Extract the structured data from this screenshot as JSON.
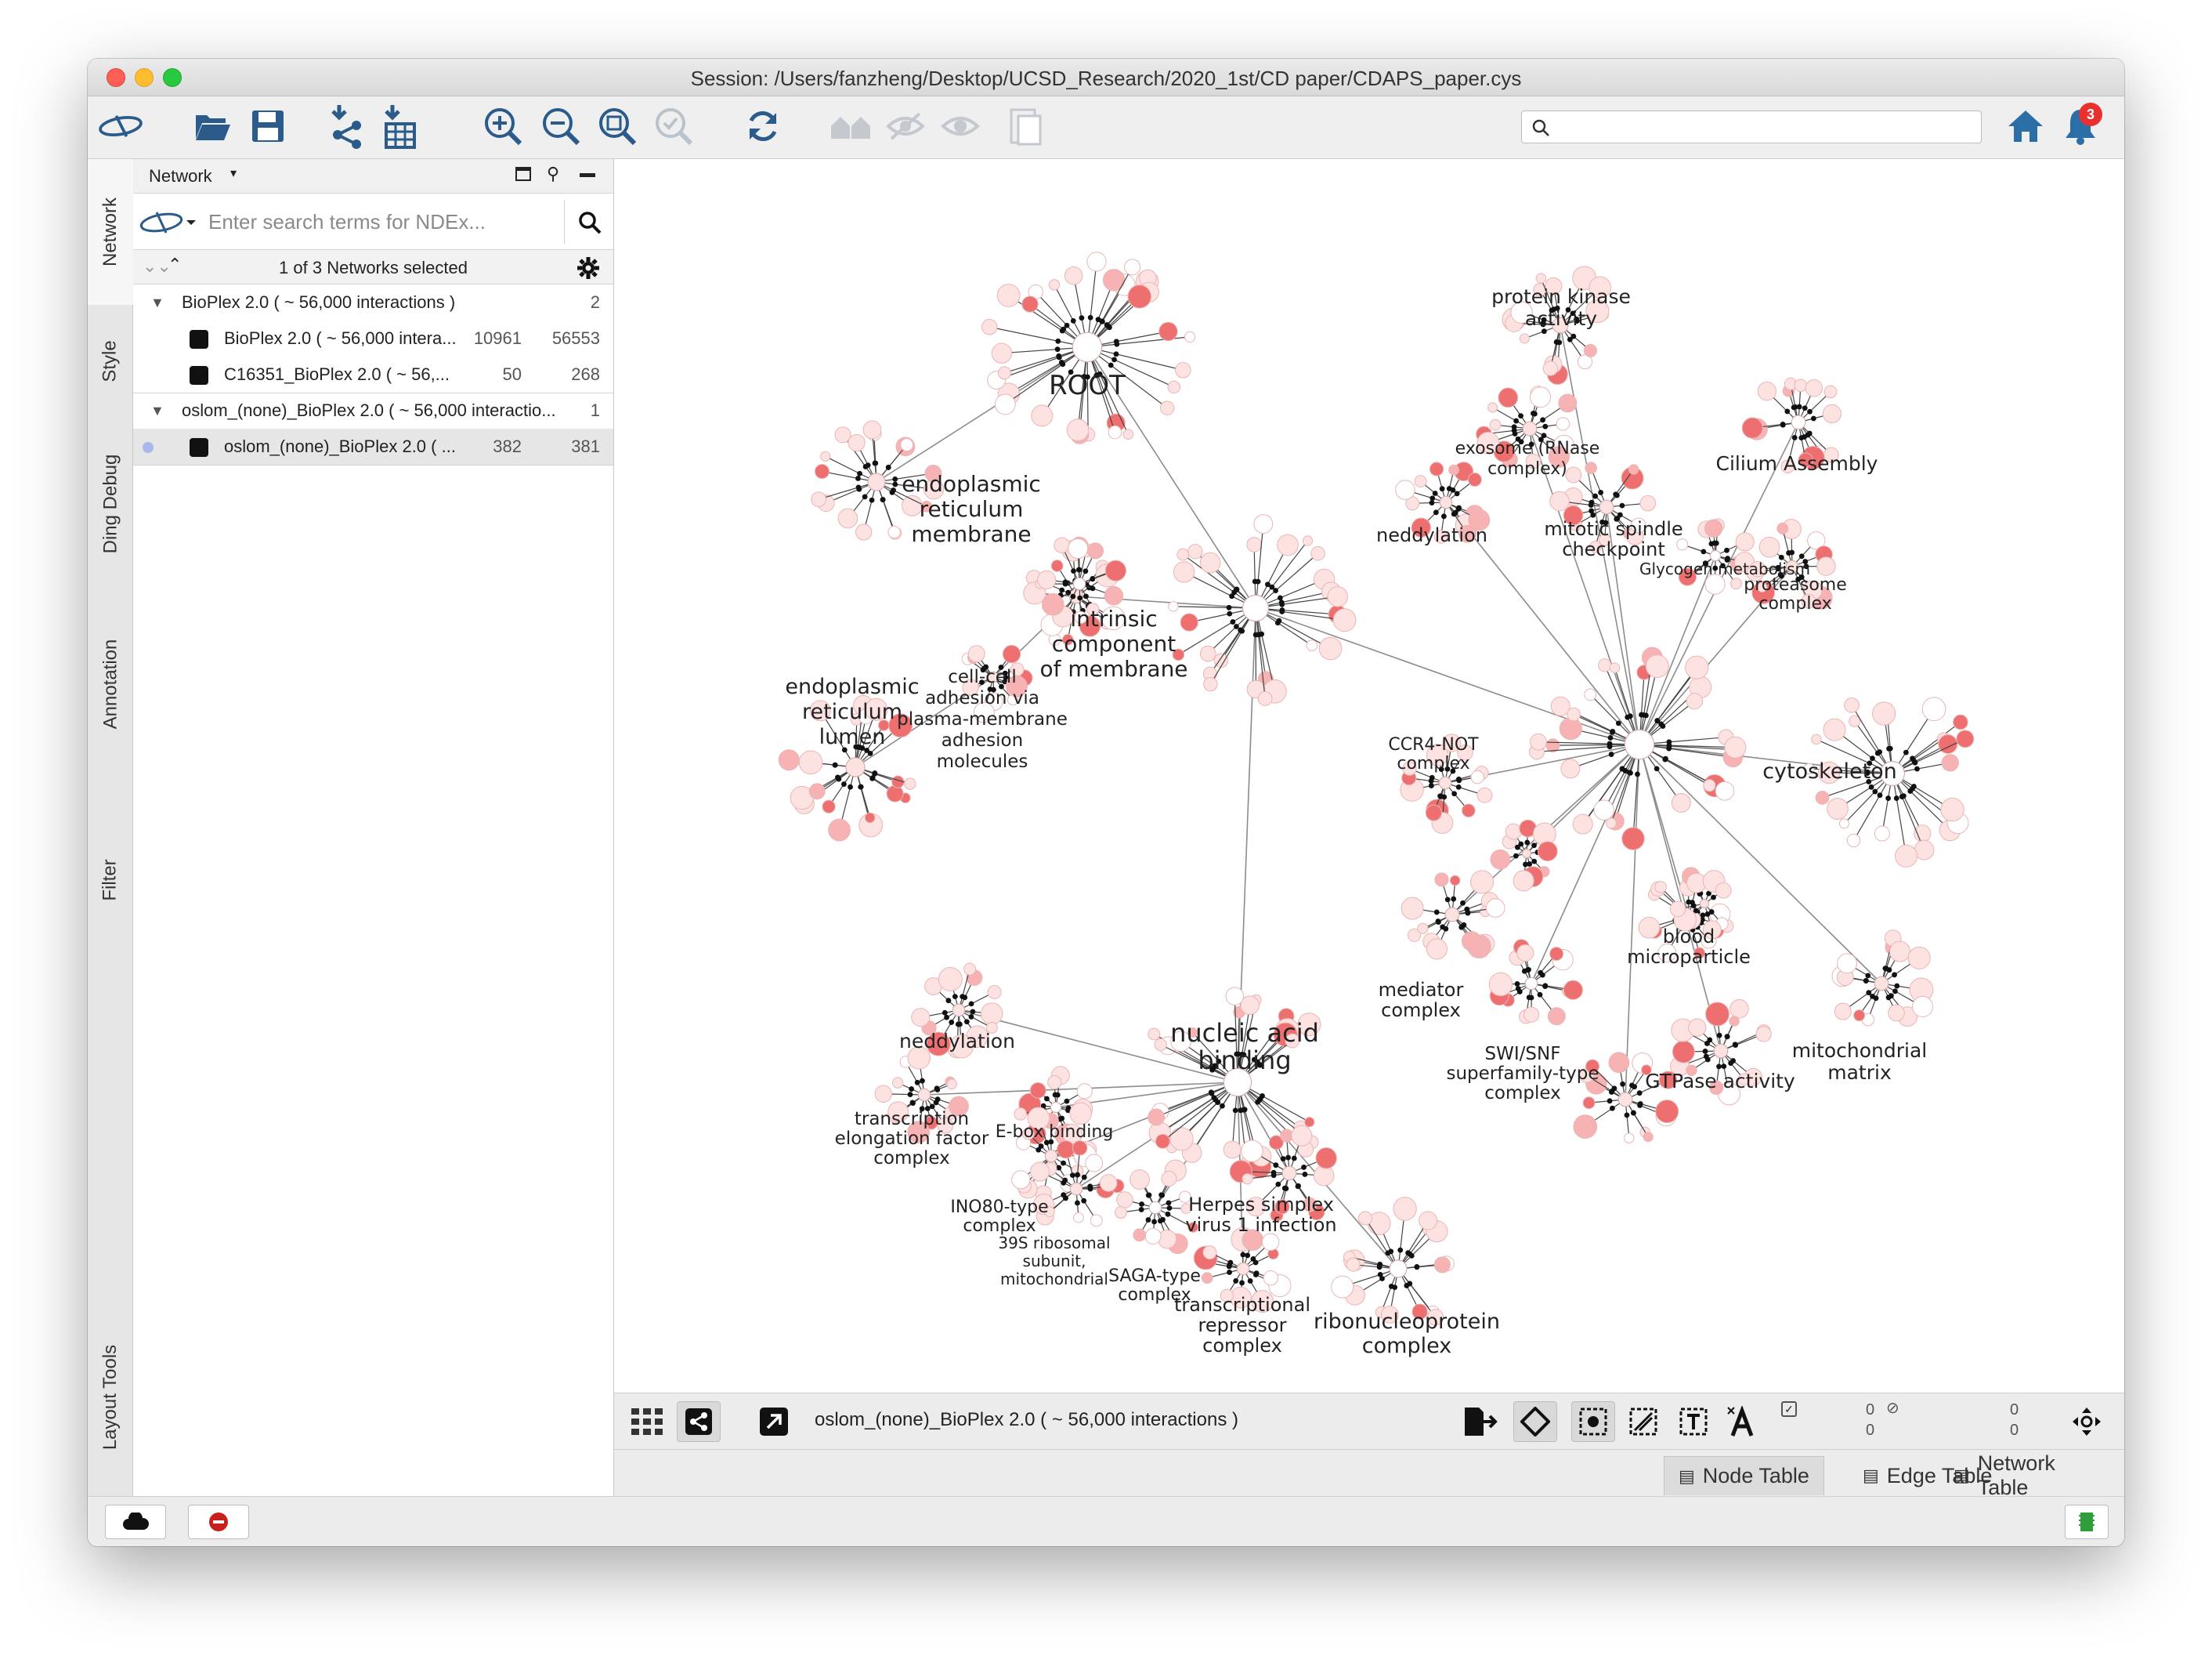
{
  "window": {
    "title": "Session: /Users/fanzheng/Desktop/UCSD_Research/2020_1st/CD paper/CDAPS_paper.cys"
  },
  "toolbar": {
    "icons": [
      "ndex-icon",
      "open-folder-icon",
      "save-icon",
      "import-network-icon",
      "import-table-icon",
      "zoom-in-icon",
      "zoom-out-icon",
      "zoom-fit-icon",
      "zoom-selected-icon",
      "refresh-icon",
      "show-neighbors-icon",
      "hide-icon",
      "show-icon",
      "clipboard-icon",
      "home-icon",
      "notifications-icon"
    ],
    "search_placeholder": "",
    "notification_count": "3"
  },
  "side_tabs": [
    "Network",
    "Style",
    "Ding Debug",
    "Annotation",
    "Filter",
    "Layout Tools"
  ],
  "panel": {
    "title": "Network",
    "ndex_placeholder": "Enter search terms for NDEx...",
    "selection_text": "1 of 3 Networks selected",
    "tree": [
      {
        "label": "BioPlex 2.0 ( ~ 56,000 interactions )",
        "count": "2",
        "kind": "collection"
      },
      {
        "label": "BioPlex 2.0 ( ~ 56,000 intera...",
        "nodes": "10961",
        "edges": "56553",
        "kind": "network"
      },
      {
        "label": "C16351_BioPlex 2.0 ( ~ 56,...",
        "nodes": "50",
        "edges": "268",
        "kind": "network"
      },
      {
        "label": "oslom_(none)_BioPlex 2.0 ( ~ 56,000 interactio...",
        "count": "1",
        "kind": "collection"
      },
      {
        "label": "oslom_(none)_BioPlex 2.0 ( ...",
        "nodes": "382",
        "edges": "381",
        "kind": "network",
        "selected": true
      }
    ]
  },
  "graph": {
    "labels": {
      "root": "ROOT",
      "er_membrane": [
        "endoplasmic",
        "reticulum",
        "membrane"
      ],
      "intrinsic": [
        "intrinsic",
        "component",
        "of membrane"
      ],
      "er_lumen": [
        "endoplasmic",
        "reticulum",
        "lumen"
      ],
      "cell_adhesion": [
        "cell-cell",
        "adhesion via",
        "plasma-membrane",
        "adhesion",
        "molecules"
      ],
      "protein_kinase": [
        "protein kinase",
        "activity"
      ],
      "exosome": [
        "exosome (RNase",
        "complex)"
      ],
      "cilium": "Cilium Assembly",
      "neddylation_top": "neddylation",
      "mitotic": [
        "mitotic spindle",
        "checkpoint"
      ],
      "glycogen": "Glycogen metabolism",
      "proteasome": [
        "proteasome",
        "complex"
      ],
      "ccr4": [
        "CCR4-NOT",
        "complex"
      ],
      "cytoskeleton": "cytoskeleton",
      "blood": [
        "blood",
        "microparticle"
      ],
      "mediator": [
        "mediator",
        "complex"
      ],
      "swi": [
        "SWI/SNF",
        "superfamily-type",
        "complex"
      ],
      "gtpase": "GTPase activity",
      "mito_matrix": [
        "mitochondrial",
        "matrix"
      ],
      "nucleic": [
        "nucleic acid",
        "binding"
      ],
      "neddylation_bottom": "neddylation",
      "transcription_elong": [
        "transcription",
        "elongation factor",
        "complex"
      ],
      "ebox": "E-box binding",
      "ino80": [
        "INO80-type",
        "complex"
      ],
      "ribosomal": [
        "39S ribosomal",
        "subunit,",
        "mitochondrial"
      ],
      "saga": [
        "SAGA-type",
        "complex"
      ],
      "herpes": [
        "Herpes simplex",
        "virus 1 infection"
      ],
      "transcriptional_rep": [
        "transcriptional",
        "repressor",
        "complex"
      ],
      "ribonucleo": [
        "ribonucleoprotein",
        "complex"
      ]
    },
    "colors": {
      "node_light": "#fde2e2",
      "node_mid": "#f7b3b3",
      "node_dark": "#ee6f6f",
      "edge": "#8c8c8c",
      "arrow": "#111111"
    }
  },
  "network_bar": {
    "title": "oslom_(none)_BioPlex 2.0 ( ~ 56,000 interactions )",
    "sel_nodes": "0",
    "total_nodes": "0",
    "sel_edges": "0",
    "total_edges": "0"
  },
  "table_tabs": [
    "Node Table",
    "Edge Table",
    "Network Table"
  ]
}
